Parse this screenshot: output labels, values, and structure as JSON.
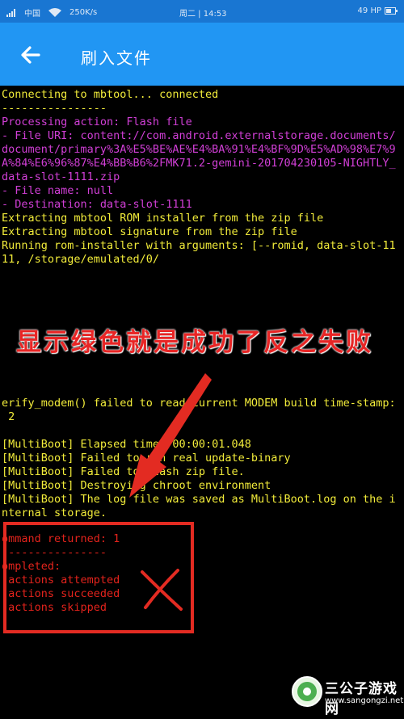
{
  "status_bar": {
    "carrier": "中国",
    "speed": "250K/s",
    "clock": "周二 | 14:53",
    "battery": "49 HP"
  },
  "toolbar": {
    "title": "刷入文件"
  },
  "console": {
    "lines": [
      {
        "text": "Connecting to mbtool... connected",
        "color": "yellow"
      },
      {
        "text": "----------------",
        "color": "yellow"
      },
      {
        "text": "Processing action: Flash file",
        "color": "magenta"
      },
      {
        "text": "- File URI: content://com.android.externalstorage.documents/",
        "color": "magenta"
      },
      {
        "text": "document/primary%3A%E5%BE%AE%E4%BA%91%E4%BF%9D%E5%AD%98%E7%9",
        "color": "magenta"
      },
      {
        "text": "A%84%E6%96%87%E4%BB%B6%2FMK71.2-gemini-201704230105-NIGHTLY_",
        "color": "magenta"
      },
      {
        "text": "data-slot-1111.zip",
        "color": "magenta"
      },
      {
        "text": "- File name: null",
        "color": "magenta"
      },
      {
        "text": "- Destination: data-slot-1111",
        "color": "magenta"
      },
      {
        "text": "Extracting mbtool ROM installer from the zip file",
        "color": "yellow"
      },
      {
        "text": "Extracting mbtool signature from the zip file",
        "color": "yellow"
      },
      {
        "text": "Running rom-installer with arguments: [--romid, data-slot-11",
        "color": "yellow"
      },
      {
        "text": "11, /storage/emulated/0/",
        "color": "yellow"
      },
      {
        "text": "erify_modem() failed to read current MODEM build time-stamp:",
        "color": "yellow"
      },
      {
        "text": " 2",
        "color": "yellow"
      },
      {
        "text": "[MultiBoot] Elapsed time: 00:00:01.048",
        "color": "yellow"
      },
      {
        "text": "[MultiBoot] Failed to run real update-binary",
        "color": "yellow"
      },
      {
        "text": "[MultiBoot] Failed to flash zip file.",
        "color": "yellow"
      },
      {
        "text": "[MultiBoot] Destroying chroot environment",
        "color": "yellow"
      },
      {
        "text": "[MultiBoot] The log file was saved as MultiBoot.log on the i",
        "color": "yellow"
      },
      {
        "text": "nternal storage.",
        "color": "yellow"
      },
      {
        "text": "ommand returned: 1",
        "color": "red"
      },
      {
        "text": "----------------",
        "color": "red"
      },
      {
        "text": "ompleted:",
        "color": "red"
      },
      {
        "text": " actions attempted",
        "color": "red"
      },
      {
        "text": " actions succeeded",
        "color": "red"
      },
      {
        "text": " actions skipped",
        "color": "red"
      }
    ]
  },
  "annotation": {
    "text": "显示绿色就是成功了反之失败"
  },
  "watermark": {
    "name": "三公子游戏网",
    "url": "www.sangongzi.net"
  },
  "colors": {
    "yellow": "#f2ec3a",
    "magenta": "#d13fd6",
    "red": "#e3231c",
    "toolbar": "#2196f3"
  }
}
